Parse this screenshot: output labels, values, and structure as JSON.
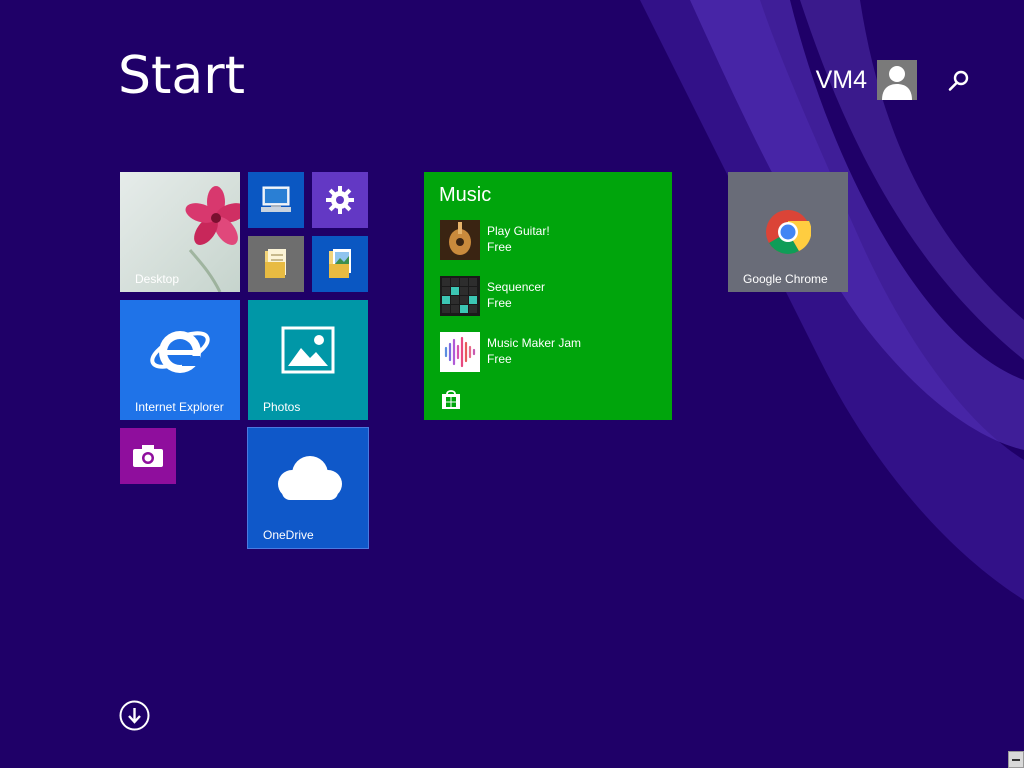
{
  "start": {
    "title": "Start"
  },
  "user": {
    "name": "VM4"
  },
  "tiles": {
    "desktop": {
      "label": "Desktop"
    },
    "internet_explorer": {
      "label": "Internet Explorer"
    },
    "photos": {
      "label": "Photos"
    },
    "onedrive": {
      "label": "OneDrive"
    },
    "chrome": {
      "label": "Google Chrome"
    }
  },
  "music": {
    "title": "Music",
    "apps": [
      {
        "name": "Play Guitar!",
        "price": "Free"
      },
      {
        "name": "Sequencer",
        "price": "Free"
      },
      {
        "name": "Music Maker Jam",
        "price": "Free"
      }
    ]
  },
  "colors": {
    "background": "#1f0068",
    "music_tile": "#00a50c",
    "ie_tile": "#1f73e8",
    "photos_tile": "#0097a7",
    "onedrive_tile": "#0f58c9",
    "camera_tile": "#8f0e9d",
    "settings_tile": "#6338c4",
    "chrome_tile": "#696c78"
  },
  "icons": [
    "user-avatar-icon",
    "search-icon",
    "this-pc-icon",
    "settings-gear-icon",
    "folder-icon",
    "library-icon",
    "ie-logo-icon",
    "photos-icon",
    "camera-icon",
    "cloud-icon",
    "chrome-logo-icon",
    "store-bag-icon",
    "arrow-down-circle-icon"
  ]
}
